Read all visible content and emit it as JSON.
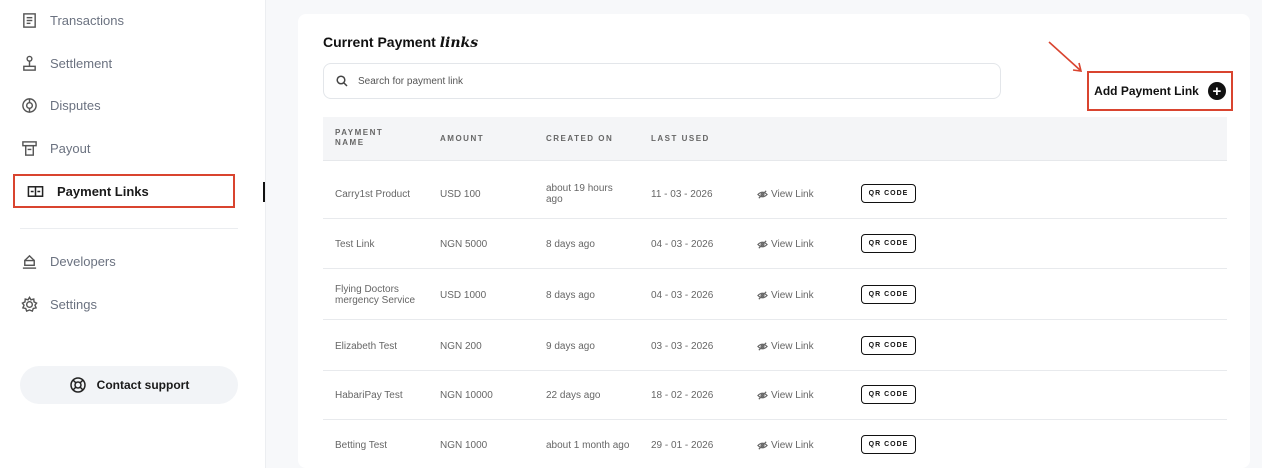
{
  "sidebar": {
    "items": [
      {
        "label": "Transactions",
        "icon": "transactions-icon"
      },
      {
        "label": "Settlement",
        "icon": "settlement-icon"
      },
      {
        "label": "Disputes",
        "icon": "disputes-icon"
      },
      {
        "label": "Payout",
        "icon": "payout-icon"
      },
      {
        "label": "Payment Links",
        "icon": "payment-links-icon",
        "active": true
      },
      {
        "label": "Developers",
        "icon": "developers-icon"
      },
      {
        "label": "Settings",
        "icon": "settings-icon"
      }
    ],
    "contact_support": "Contact support"
  },
  "main": {
    "title_prefix": "Current Payment",
    "title_emphasis": "links",
    "search_placeholder": "Search for payment link",
    "add_button_label": "Add Payment Link",
    "table": {
      "headers": [
        "PAYMENT NAME",
        "AMOUNT",
        "CREATED ON",
        "LAST USED"
      ],
      "view_link_label": "View Link",
      "qr_label": "QR CODE",
      "rows": [
        {
          "name": "Carry1st Product",
          "amount": "USD 100",
          "created": "about 19 hours ago",
          "last_used": "11 - 03 - 2026"
        },
        {
          "name": "Test Link",
          "amount": "NGN 5000",
          "created": "8 days ago",
          "last_used": "04 - 03 - 2026"
        },
        {
          "name": "Flying Doctors mergency Service",
          "amount": "USD 1000",
          "created": "8 days ago",
          "last_used": "04 - 03 - 2026"
        },
        {
          "name": "Elizabeth Test",
          "amount": "NGN 200",
          "created": "9 days ago",
          "last_used": "03 - 03 - 2026"
        },
        {
          "name": "HabariPay Test",
          "amount": "NGN 10000",
          "created": "22 days ago",
          "last_used": "18 - 02 - 2026"
        },
        {
          "name": "Betting Test",
          "amount": "NGN 1000",
          "created": "about 1 month ago",
          "last_used": "29 - 01 - 2026"
        }
      ]
    }
  },
  "colors": {
    "highlight": "#d9442f",
    "text_dark": "#111111",
    "text_muted": "#666666",
    "header_bg": "#f4f5f7"
  }
}
